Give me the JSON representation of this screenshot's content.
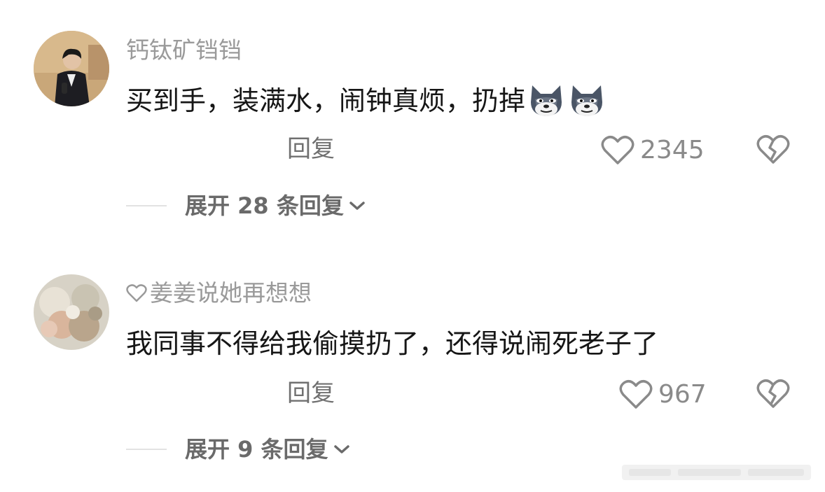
{
  "comments": [
    {
      "username": "钙钛矿铛铛",
      "content": "买到手，装满水，闹钟真烦，扔掉",
      "emoji_count": 2,
      "emoji_icon": "wolf-face-emoji",
      "reply_label": "回复",
      "like_count": "2345",
      "expand_label": "展开 28 条回复"
    },
    {
      "username_prefix_icon": "heart-outline-icon",
      "username": "姜姜说她再想想",
      "content": "我同事不得给我偷摸扔了，还得说闹死老子了",
      "reply_label": "回复",
      "like_count": "967",
      "expand_label": "展开 9 条回复"
    }
  ],
  "colors": {
    "username": "#9a9a9a",
    "content": "#161616",
    "meta": "#8a8a8a",
    "expand": "#6a6a6a",
    "divider": "#e2e2e2"
  }
}
